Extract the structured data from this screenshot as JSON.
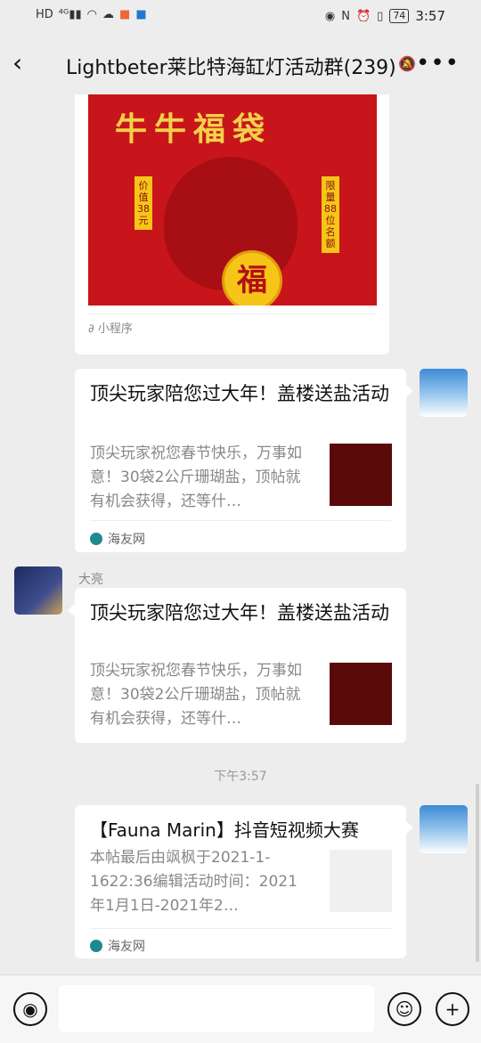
{
  "status": {
    "left_icons": [
      "HD",
      "4G",
      "signal-icon",
      "wifi-icon",
      "cloud-icon",
      "app-icon",
      "app-icon"
    ],
    "battery": "74",
    "time": "3:57"
  },
  "header": {
    "back_icon": "‹",
    "title": "Lightbeter莱比特海缸灯活动群(239)",
    "more_icon": "•••"
  },
  "messages": {
    "mini": {
      "banner_title": "牛牛福袋",
      "fu": "福",
      "price_tag": "价值38元",
      "limit_tag": "限量88位名额",
      "source": "小程序"
    },
    "link1": {
      "title": "顶尖玩家陪您过大年！盖楼送盐活动",
      "desc": "顶尖玩家祝您春节快乐，万事如意！30袋2公斤珊瑚盐，顶帖就有机会获得，还等什…",
      "source": "海友网"
    },
    "sender_name": "大亮",
    "link2": {
      "title": "顶尖玩家陪您过大年！盖楼送盐活动",
      "desc": "顶尖玩家祝您春节快乐，万事如意！30袋2公斤珊瑚盐，顶帖就有机会获得，还等什…"
    },
    "timestamp": "下午3:57",
    "link3": {
      "title": "【Fauna Marin】抖音短视频大赛",
      "desc": "本帖最后由飒枫于2021-1-1622:36编辑活动时间：2021年1月1日-2021年2…",
      "source": "海友网"
    }
  },
  "input_bar": {
    "voice_icon": "voice-icon",
    "emoji_icon": "emoji-icon",
    "plus_icon": "plus-icon"
  }
}
